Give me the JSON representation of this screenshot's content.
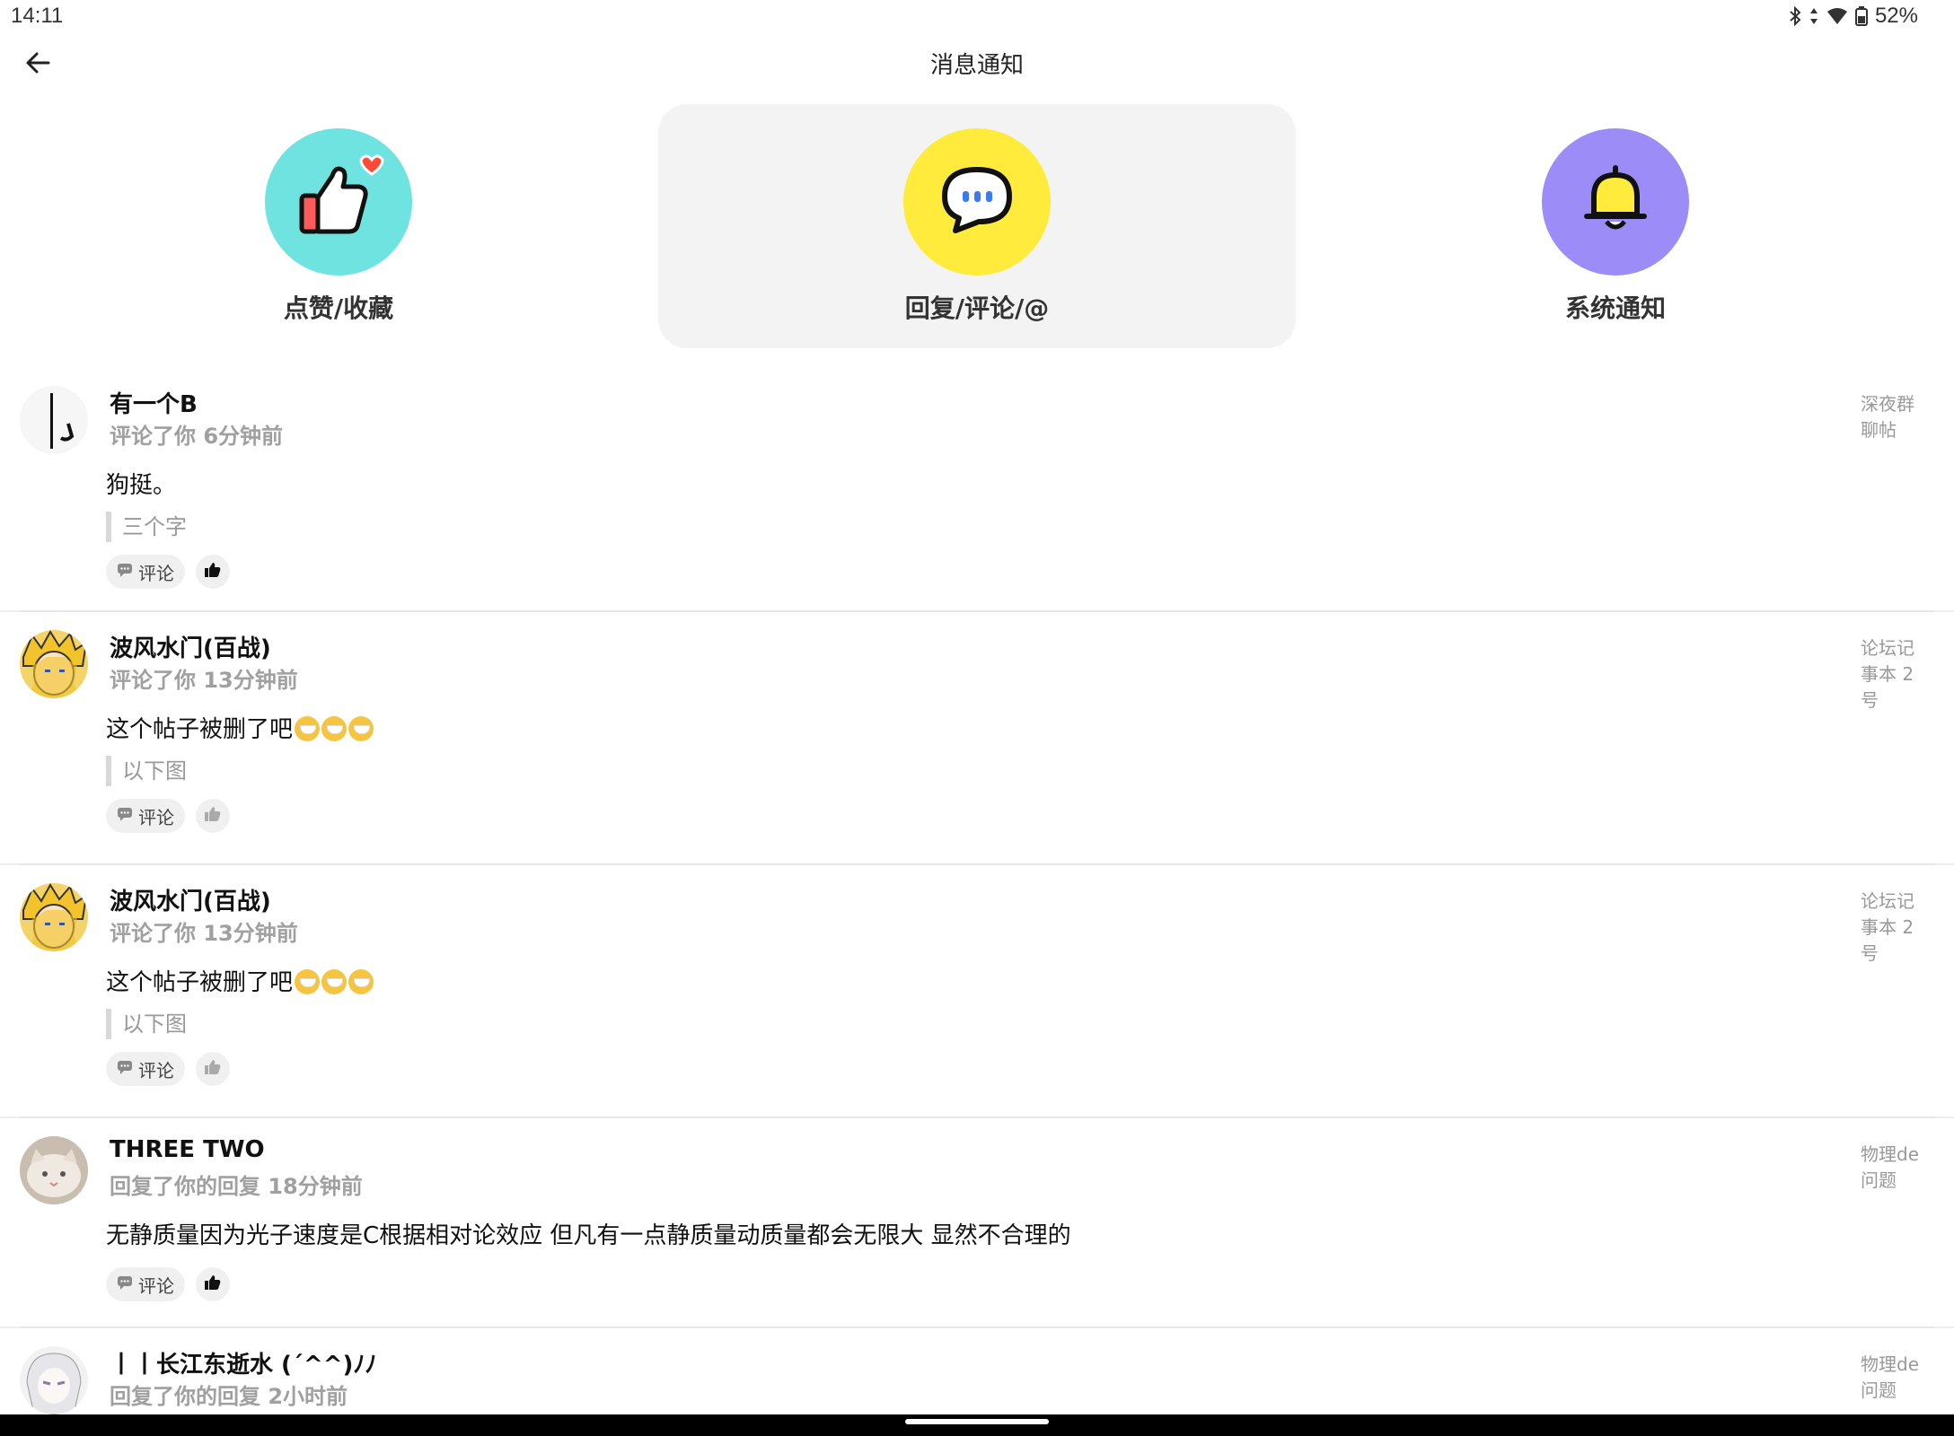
{
  "status_bar": {
    "time": "14:11",
    "battery": "52%",
    "icons": [
      "bluetooth-icon",
      "data-arrows-icon",
      "wifi-icon",
      "battery-icon"
    ]
  },
  "header": {
    "title": "消息通知",
    "back_icon": "back-arrow-icon"
  },
  "categories": [
    {
      "label": "点赞/收藏",
      "icon": "thumbs-up-heart-icon",
      "color": "#6ee3df",
      "active": false
    },
    {
      "label": "回复/评论/@",
      "icon": "chat-bubble-icon",
      "color": "#ffeb3b",
      "active": true
    },
    {
      "label": "系统通知",
      "icon": "bell-icon",
      "color": "#9b8cf7",
      "active": false
    }
  ],
  "notifications": [
    {
      "user": "有一个B",
      "meta": "评论了你 6分钟前",
      "content": "狗挺。",
      "quote": "三个字",
      "source": "深夜群聊帖",
      "comment_label": "评论",
      "liked": true
    },
    {
      "user": "波风水门(百战)",
      "meta": "评论了你 13分钟前",
      "content": "这个帖子被删了吧",
      "emoji_count": 3,
      "quote": "以下图",
      "source": "论坛记事本 2 号",
      "comment_label": "评论",
      "liked": false
    },
    {
      "user": "波风水门(百战)",
      "meta": "评论了你 13分钟前",
      "content": "这个帖子被删了吧",
      "emoji_count": 3,
      "quote": "以下图",
      "source": "论坛记事本 2 号",
      "comment_label": "评论",
      "liked": false
    },
    {
      "user": "THREE TWO",
      "meta": "回复了你的回复 18分钟前",
      "content": "无静质量因为光子速度是C根据相对论效应 但凡有一点静质量动质量都会无限大 显然不合理的",
      "source": "物理de问题",
      "comment_label": "评论",
      "liked": true
    },
    {
      "user": "丨丨长江东逝水 (´^^)ﾉﾉ",
      "meta": "回复了你的回复 2小时前",
      "source": "物理de问题"
    }
  ],
  "colors": {
    "accent_teal": "#6ee3df",
    "accent_yellow": "#ffeb3b",
    "accent_purple": "#9b8cf7",
    "meta_gray": "#a0a0a0"
  }
}
